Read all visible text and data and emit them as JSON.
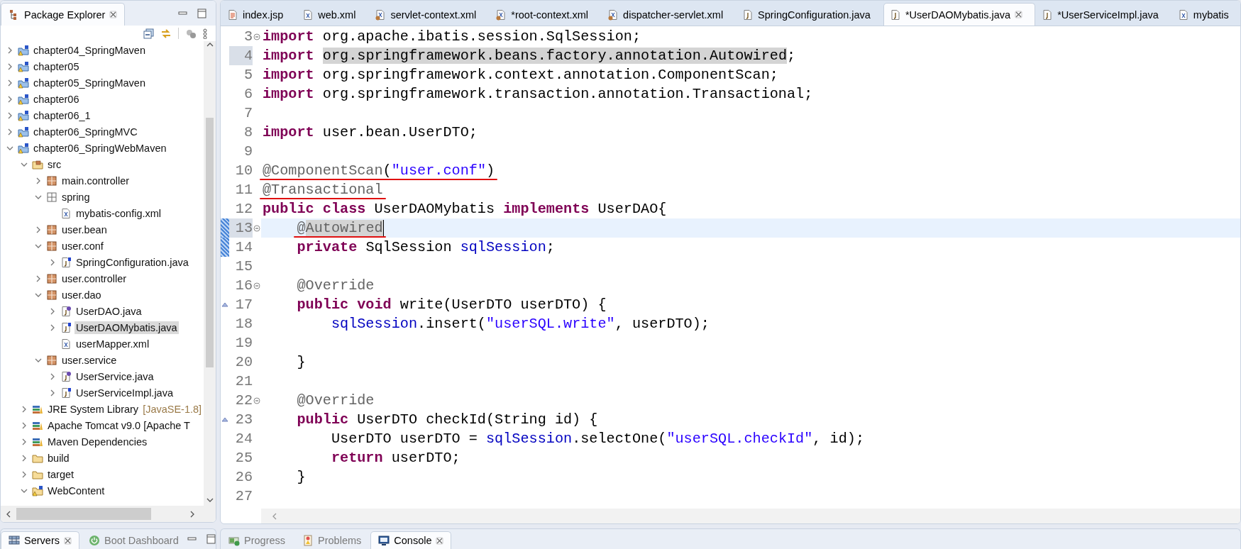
{
  "package_explorer": {
    "tabs": [
      {
        "label": "Package Explorer",
        "kind": "explorer",
        "selected": true
      }
    ],
    "tree": [
      {
        "label": "chapter04_SpringMaven",
        "kind": "project",
        "expanded": false,
        "selected": false
      },
      {
        "label": "chapter05",
        "kind": "project",
        "expanded": false,
        "selected": false
      },
      {
        "label": "chapter05_SpringMaven",
        "kind": "project",
        "expanded": false,
        "selected": false
      },
      {
        "label": "chapter06",
        "kind": "project",
        "expanded": false,
        "selected": false
      },
      {
        "label": "chapter06_1",
        "kind": "project",
        "expanded": false,
        "selected": false
      },
      {
        "label": "chapter06_SpringMVC",
        "kind": "project",
        "expanded": false,
        "selected": false
      },
      {
        "label": "chapter06_SpringWebMaven",
        "kind": "project",
        "expanded": true,
        "selected": false,
        "children": [
          {
            "label": "src",
            "kind": "source-folder",
            "expanded": true,
            "selected": false,
            "children": [
              {
                "label": "main.controller",
                "kind": "package",
                "expanded": false,
                "selected": false
              },
              {
                "label": "spring",
                "kind": "package-plain",
                "expanded": true,
                "selected": false,
                "children": [
                  {
                    "label": "mybatis-config.xml",
                    "kind": "xml-file",
                    "selected": false
                  }
                ]
              },
              {
                "label": "user.bean",
                "kind": "package",
                "expanded": false,
                "selected": false
              },
              {
                "label": "user.conf",
                "kind": "package",
                "expanded": true,
                "selected": false,
                "children": [
                  {
                    "label": "SpringConfiguration.java",
                    "kind": "java-file",
                    "expanded": false,
                    "selected": false
                  }
                ]
              },
              {
                "label": "user.controller",
                "kind": "package",
                "expanded": false,
                "selected": false
              },
              {
                "label": "user.dao",
                "kind": "package",
                "expanded": true,
                "selected": false,
                "children": [
                  {
                    "label": "UserDAO.java",
                    "kind": "interface-file",
                    "expanded": false,
                    "selected": false
                  },
                  {
                    "label": "UserDAOMybatis.java",
                    "kind": "java-file",
                    "expanded": false,
                    "selected": true
                  },
                  {
                    "label": "userMapper.xml",
                    "kind": "xml-file",
                    "selected": false
                  }
                ]
              },
              {
                "label": "user.service",
                "kind": "package",
                "expanded": true,
                "selected": false,
                "children": [
                  {
                    "label": "UserService.java",
                    "kind": "interface-file",
                    "expanded": false,
                    "selected": false
                  },
                  {
                    "label": "UserServiceImpl.java",
                    "kind": "java-file",
                    "expanded": false,
                    "selected": false
                  }
                ]
              }
            ]
          },
          {
            "label": "JRE System Library",
            "suffix": "[JavaSE-1.8]",
            "kind": "library",
            "expanded": false,
            "selected": false
          },
          {
            "label": "Apache Tomcat v9.0 [Apache T",
            "kind": "library",
            "expanded": false,
            "selected": false
          },
          {
            "label": "Maven Dependencies",
            "kind": "library",
            "expanded": false,
            "selected": false
          },
          {
            "label": "build",
            "kind": "folder",
            "expanded": false,
            "selected": false
          },
          {
            "label": "target",
            "kind": "folder",
            "expanded": false,
            "selected": false
          },
          {
            "label": "WebContent",
            "kind": "web-folder",
            "expanded": true,
            "selected": false
          }
        ]
      }
    ]
  },
  "editor": {
    "tabs": [
      {
        "label": "index.jsp",
        "kind": "jsp",
        "selected": false
      },
      {
        "label": "web.xml",
        "kind": "xml",
        "selected": false
      },
      {
        "label": "servlet-context.xml",
        "kind": "spring-xml",
        "selected": false
      },
      {
        "label": "*root-context.xml",
        "kind": "spring-xml",
        "selected": false
      },
      {
        "label": "dispatcher-servlet.xml",
        "kind": "spring-xml",
        "selected": false
      },
      {
        "label": "SpringConfiguration.java",
        "kind": "java",
        "selected": false
      },
      {
        "label": "*UserDAOMybatis.java",
        "kind": "java",
        "selected": true
      },
      {
        "label": "*UserServiceImpl.java",
        "kind": "java",
        "selected": false
      },
      {
        "label": "mybatis",
        "kind": "xml",
        "selected": false
      }
    ],
    "lines": [
      {
        "number": "3",
        "foldable": true,
        "tokens": [
          {
            "kind": "keyword",
            "text": "import"
          },
          {
            "kind": "plain",
            "text": " org.apache.ibatis.session.SqlSession;"
          }
        ]
      },
      {
        "number": "4",
        "tokens": [
          {
            "kind": "keyword",
            "text": "import "
          },
          {
            "kind": "plain",
            "text": "org.springframework.beans.factory.annotation.Autowired",
            "marked": true
          },
          {
            "kind": "plain",
            "text": ";"
          }
        ]
      },
      {
        "number": "5",
        "tokens": [
          {
            "kind": "keyword",
            "text": "import"
          },
          {
            "kind": "plain",
            "text": " org.springframework.context.annotation.ComponentScan;"
          }
        ]
      },
      {
        "number": "6",
        "tokens": [
          {
            "kind": "keyword",
            "text": "import"
          },
          {
            "kind": "plain",
            "text": " org.springframework.transaction.annotation.Transactional;"
          }
        ]
      },
      {
        "number": "7"
      },
      {
        "number": "8",
        "tokens": [
          {
            "kind": "keyword",
            "text": "import"
          },
          {
            "kind": "plain",
            "text": " user.bean.UserDTO;"
          }
        ]
      },
      {
        "number": "9"
      },
      {
        "number": "10",
        "underlined": true,
        "tokens": [
          {
            "kind": "annotation",
            "text": "@ComponentScan"
          },
          {
            "kind": "plain",
            "text": "("
          },
          {
            "kind": "string",
            "text": "\"user.conf\""
          },
          {
            "kind": "plain",
            "text": ")"
          }
        ]
      },
      {
        "number": "11",
        "underlined": true,
        "tokens": [
          {
            "kind": "annotation",
            "text": "@Transactional"
          }
        ]
      },
      {
        "number": "12",
        "tokens": [
          {
            "kind": "keyword",
            "text": "public class"
          },
          {
            "kind": "plain",
            "text": " UserDAOMybatis "
          },
          {
            "kind": "keyword",
            "text": "implements"
          },
          {
            "kind": "plain",
            "text": " UserDAO{"
          }
        ],
        "children": [
          {
            "number": "13",
            "foldable": true,
            "current": true,
            "changed": true,
            "underlined": true,
            "cursor": true,
            "tokens": [
              {
                "kind": "annotation",
                "text": "@"
              },
              {
                "kind": "annotation",
                "text": "Autowired",
                "marked": true
              }
            ]
          },
          {
            "number": "14",
            "changed": true,
            "tokens": [
              {
                "kind": "keyword",
                "text": "private"
              },
              {
                "kind": "plain",
                "text": " SqlSession "
              },
              {
                "kind": "field",
                "text": "sqlSession"
              },
              {
                "kind": "plain",
                "text": ";"
              }
            ]
          },
          {
            "number": "15"
          },
          {
            "number": "16",
            "foldable": true,
            "tokens": [
              {
                "kind": "annotation",
                "text": "@Override"
              }
            ]
          },
          {
            "number": "17",
            "override": true,
            "tokens": [
              {
                "kind": "keyword",
                "text": "public void"
              },
              {
                "kind": "plain",
                "text": " write(UserDTO userDTO) {"
              }
            ],
            "children": [
              {
                "number": "18",
                "tokens": [
                  {
                    "kind": "field",
                    "text": "sqlSession"
                  },
                  {
                    "kind": "plain",
                    "text": ".insert("
                  },
                  {
                    "kind": "string",
                    "text": "\"userSQL.write\""
                  },
                  {
                    "kind": "plain",
                    "text": ", userDTO);"
                  }
                ]
              },
              {
                "number": "19"
              }
            ]
          },
          {
            "number": "20",
            "tokens": [
              {
                "kind": "plain",
                "text": "}"
              }
            ]
          },
          {
            "number": "21"
          },
          {
            "number": "22",
            "foldable": true,
            "tokens": [
              {
                "kind": "annotation",
                "text": "@Override"
              }
            ]
          },
          {
            "number": "23",
            "override": true,
            "tokens": [
              {
                "kind": "keyword",
                "text": "public"
              },
              {
                "kind": "plain",
                "text": " UserDTO checkId(String id) {"
              }
            ],
            "children": [
              {
                "number": "24",
                "tokens": [
                  {
                    "kind": "plain",
                    "text": "UserDTO userDTO = "
                  },
                  {
                    "kind": "field",
                    "text": "sqlSession"
                  },
                  {
                    "kind": "plain",
                    "text": ".selectOne("
                  },
                  {
                    "kind": "string",
                    "text": "\"userSQL.checkId\""
                  },
                  {
                    "kind": "plain",
                    "text": ", id);"
                  }
                ]
              },
              {
                "number": "25",
                "tokens": [
                  {
                    "kind": "keyword",
                    "text": "return"
                  },
                  {
                    "kind": "plain",
                    "text": " userDTO;"
                  }
                ]
              }
            ]
          },
          {
            "number": "26",
            "tokens": [
              {
                "kind": "plain",
                "text": "}"
              }
            ]
          }
        ]
      },
      {
        "number": "27"
      }
    ]
  },
  "servers_panel": {
    "tabs": [
      {
        "label": "Servers",
        "kind": "servers",
        "selected": true
      },
      {
        "label": "Boot Dashboard",
        "kind": "boot",
        "selected": false
      }
    ]
  },
  "bottom_panel": {
    "tabs": [
      {
        "label": "Progress",
        "kind": "progress",
        "selected": false
      },
      {
        "label": "Problems",
        "kind": "problems",
        "selected": false
      },
      {
        "label": "Console",
        "kind": "console",
        "selected": true
      }
    ]
  }
}
